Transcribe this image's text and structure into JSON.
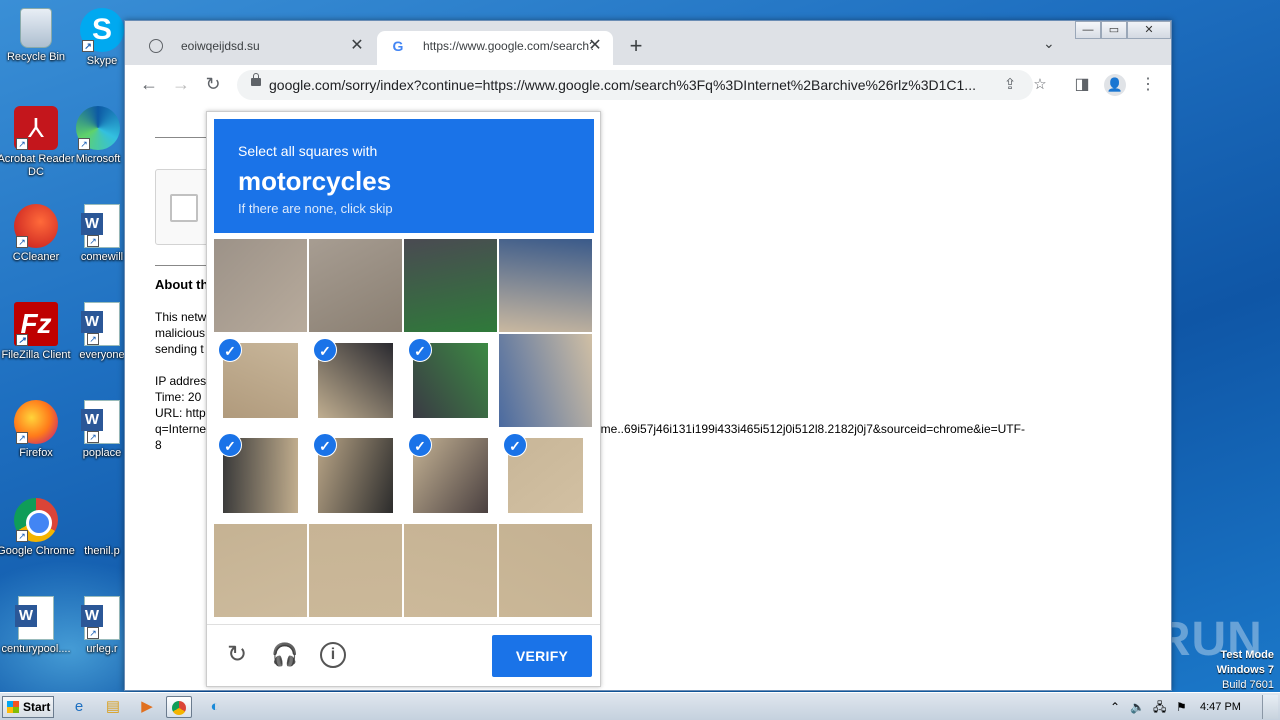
{
  "desktop": {
    "icons": [
      {
        "label": "Recycle Bin",
        "icon": "recycle-bin-icon"
      },
      {
        "label": "Skype",
        "icon": "skype-icon"
      },
      {
        "label": "Acrobat Reader DC",
        "icon": "acrobat-icon"
      },
      {
        "label": "Microsoft",
        "icon": "edge-icon"
      },
      {
        "label": "CCleaner",
        "icon": "ccleaner-icon"
      },
      {
        "label": "comewill",
        "icon": "word-doc-icon"
      },
      {
        "label": "FileZilla Client",
        "icon": "filezilla-icon"
      },
      {
        "label": "everyone",
        "icon": "word-doc-icon"
      },
      {
        "label": "Firefox",
        "icon": "firefox-icon"
      },
      {
        "label": "poplace",
        "icon": "word-doc-icon"
      },
      {
        "label": "Google Chrome",
        "icon": "chrome-icon"
      },
      {
        "label": "thenil.p",
        "icon": "blank-file-icon"
      },
      {
        "label": "centurypool....",
        "icon": "word-doc-icon"
      },
      {
        "label": "urleg.r",
        "icon": "word-doc-icon"
      }
    ],
    "watermark": "ANY RUN",
    "test_mode": {
      "line1": "Test Mode",
      "line2": "Windows 7",
      "line3": "Build 7601"
    }
  },
  "browser": {
    "tabs": [
      {
        "title": "eoiwqeijdsd.su",
        "icon": "globe-icon",
        "active": false
      },
      {
        "title": "https://www.google.com/search?q=",
        "icon": "google-g-icon",
        "active": true
      }
    ],
    "url": "google.com/sorry/index?continue=https://www.google.com/search%3Fq%3DInternet%2Barchive%26rlz%3D1C1...",
    "window_controls": {
      "minimize": "—",
      "maximize": "▭",
      "close": "✕"
    }
  },
  "page": {
    "about_heading": "About th",
    "para_lines": [
      "This netw",
      "malicious",
      "sending t"
    ],
    "ip_label": "IP addres",
    "time_label": "Time: 20",
    "url_label": "URL: http",
    "url_cont_left": "q=Interne",
    "url_cont_right": "ome..69i57j46i131i199i433i465i512j0i512l8.2182j0j7&sourceid=chrome&ie=UTF-",
    "url_end": "8"
  },
  "captcha": {
    "prompt_line1": "Select all squares with",
    "prompt_object": "motorcycles",
    "prompt_line3": "If there are none, click skip",
    "tiles_selected": [
      false,
      false,
      false,
      false,
      true,
      true,
      true,
      false,
      true,
      true,
      true,
      true,
      false,
      false,
      false,
      false
    ],
    "check_glyph": "✓",
    "verify_label": "VERIFY",
    "icons": {
      "reload": "↻",
      "audio": "🎧",
      "info": "i"
    }
  },
  "taskbar": {
    "start_label": "Start",
    "clock": "4:47 PM"
  },
  "colors": {
    "accent": "#1a73e8"
  }
}
